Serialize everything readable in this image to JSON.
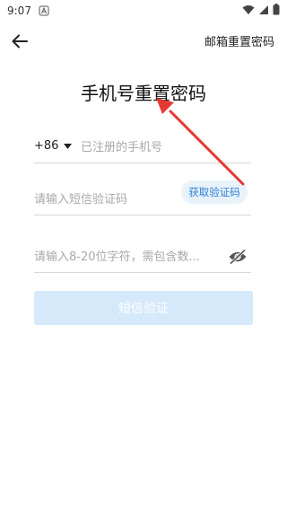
{
  "status_bar": {
    "time": "9:07"
  },
  "app_bar": {
    "email_reset_label": "邮箱重置密码"
  },
  "page": {
    "title": "手机号重置密码"
  },
  "phone": {
    "country_code": "+86",
    "placeholder": "已注册的手机号"
  },
  "sms_code": {
    "placeholder": "请输入短信验证码",
    "get_code_label": "获取验证码"
  },
  "password": {
    "placeholder": "请输入8-20位字符，需包含数..."
  },
  "submit": {
    "label": "短信验证"
  },
  "colors": {
    "accent": "#2f7fd6",
    "accent_bg": "#e8f2fb",
    "submit_bg": "#d5e9fb",
    "annotation": "#e53935"
  },
  "icons": {
    "back": "arrow-left-icon",
    "dropdown": "caret-down-icon",
    "password_toggle": "eye-off-icon",
    "wifi": "wifi-icon",
    "signal": "signal-icon",
    "battery": "battery-icon"
  }
}
